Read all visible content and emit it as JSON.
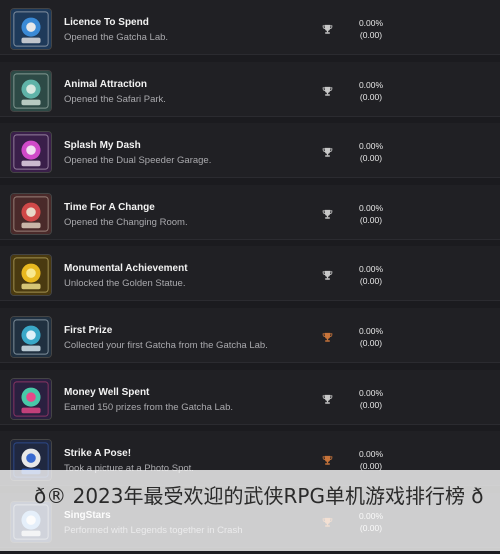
{
  "achievements": [
    {
      "title": "Licence To Spend",
      "description": "Opened the Gatcha Lab.",
      "trophy": "silver-trophy-icon",
      "trophy_color": "#c8c8c8",
      "percent": "0.00%",
      "percent_sub": "(0.00)",
      "badge_icon": "gatcha-lab-badge-icon",
      "badge_colors": [
        "#1e3a5a",
        "#3a8ad6",
        "#e8e8e8"
      ]
    },
    {
      "title": "Animal Attraction",
      "description": "Opened the Safari Park.",
      "trophy": "silver-trophy-icon",
      "trophy_color": "#c8c8c8",
      "percent": "0.00%",
      "percent_sub": "(0.00)",
      "badge_icon": "safari-park-badge-icon",
      "badge_colors": [
        "#2d4a46",
        "#5fb3a8",
        "#d9e8e0"
      ]
    },
    {
      "title": "Splash My Dash",
      "description": "Opened the Dual Speeder Garage.",
      "trophy": "silver-trophy-icon",
      "trophy_color": "#c8c8c8",
      "percent": "0.00%",
      "percent_sub": "(0.00)",
      "badge_icon": "speeder-garage-badge-icon",
      "badge_colors": [
        "#3a1f4a",
        "#d04ac8",
        "#f0e0f0"
      ]
    },
    {
      "title": "Time For A Change",
      "description": "Opened the Changing Room.",
      "trophy": "silver-trophy-icon",
      "trophy_color": "#c8c8c8",
      "percent": "0.00%",
      "percent_sub": "(0.00)",
      "badge_icon": "changing-room-badge-icon",
      "badge_colors": [
        "#4a2a2a",
        "#d04848",
        "#e8d8c8"
      ]
    },
    {
      "title": "Monumental Achievement",
      "description": "Unlocked the Golden Statue.",
      "trophy": "silver-trophy-icon",
      "trophy_color": "#c8c8c8",
      "percent": "0.00%",
      "percent_sub": "(0.00)",
      "badge_icon": "golden-statue-badge-icon",
      "badge_colors": [
        "#4a3a10",
        "#e8b820",
        "#f8e890"
      ]
    },
    {
      "title": "First Prize",
      "description": "Collected your first Gatcha from the Gatcha Lab.",
      "trophy": "bronze-trophy-icon",
      "trophy_color": "#c8743a",
      "percent": "0.00%",
      "percent_sub": "(0.00)",
      "badge_icon": "first-prize-badge-icon",
      "badge_colors": [
        "#203040",
        "#3aa8c8",
        "#e0f0f8"
      ]
    },
    {
      "title": "Money Well Spent",
      "description": "Earned 150 prizes from the Gatcha Lab.",
      "trophy": "silver-trophy-icon",
      "trophy_color": "#c8c8c8",
      "percent": "0.00%",
      "percent_sub": "(0.00)",
      "badge_icon": "money-well-spent-badge-icon",
      "badge_colors": [
        "#2a2040",
        "#48c8a8",
        "#e84888"
      ]
    },
    {
      "title": "Strike A Pose!",
      "description": "Took a picture at a Photo Spot.",
      "trophy": "bronze-trophy-icon",
      "trophy_color": "#c8743a",
      "percent": "0.00%",
      "percent_sub": "(0.00)",
      "badge_icon": "photo-spot-badge-icon",
      "badge_colors": [
        "#202840",
        "#e8e8e8",
        "#3a6ad0"
      ]
    },
    {
      "title": "SingStars",
      "description": "Performed with Legends together in Crash",
      "trophy": "bronze-trophy-icon",
      "trophy_color": "#c8743a",
      "percent": "0.00%",
      "percent_sub": "(0.00)",
      "badge_icon": "singstars-badge-icon",
      "badge_colors": [
        "#2a3a5a",
        "#88b8e8",
        "#f0f0f0"
      ]
    }
  ],
  "overlay": {
    "text": "ð®  2023年最受欢迎的武侠RPG单机游戏排行榜  ð"
  }
}
